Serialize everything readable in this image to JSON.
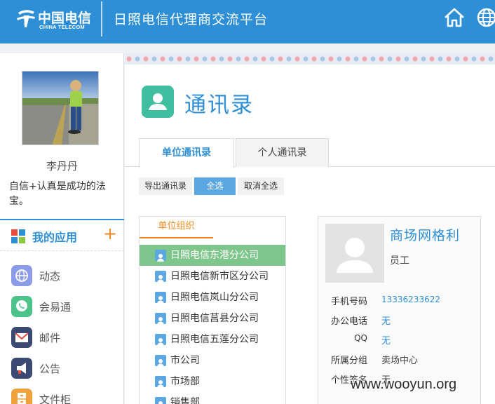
{
  "header": {
    "brand_cn": "中国电信",
    "brand_en": "CHINA TELECOM",
    "title": "日照电信代理商交流平台"
  },
  "sidebar": {
    "user_name": "李丹丹",
    "motto": "自信+认真是成功的法宝。",
    "apps_title": "我的应用",
    "apps_add": "+",
    "apps": [
      {
        "label": "动态",
        "icon": "globe-icon",
        "color": "#8b9be8"
      },
      {
        "label": "会易通",
        "icon": "phone-chat-icon",
        "color": "#4cc38a"
      },
      {
        "label": "邮件",
        "icon": "mail-icon",
        "color": "#3b4a72"
      },
      {
        "label": "公告",
        "icon": "megaphone-icon",
        "color": "#3b4a72"
      },
      {
        "label": "文件柜",
        "icon": "cabinet-icon",
        "color": "#f0a23a"
      }
    ]
  },
  "main": {
    "page_title": "通讯录",
    "tabs": [
      {
        "label": "单位通讯录",
        "active": true
      },
      {
        "label": "个人通讯录",
        "active": false
      }
    ],
    "buttons": {
      "export": "导出通讯录",
      "select_all": "全选",
      "deselect_all": "取消全选"
    },
    "org_tab": "单位组织",
    "org_list": [
      {
        "label": "日照电信东港分公司",
        "selected": true
      },
      {
        "label": "日照电信新市区分公司",
        "selected": false
      },
      {
        "label": "日照电信岚山分公司",
        "selected": false
      },
      {
        "label": "日照电信莒县分公司",
        "selected": false
      },
      {
        "label": "日照电信五莲分公司",
        "selected": false
      },
      {
        "label": "市公司",
        "selected": false
      },
      {
        "label": "市场部",
        "selected": false
      },
      {
        "label": "销售部",
        "selected": false
      }
    ],
    "contact": {
      "name": "商场网格利",
      "role": "员工",
      "fields": [
        {
          "label": "手机号码",
          "value": "13336233622",
          "link": true
        },
        {
          "label": "办公电话",
          "value": "无",
          "link": true
        },
        {
          "label": "QQ",
          "value": "无",
          "link": true
        },
        {
          "label": "所属分组",
          "value": "卖场中心",
          "link": false
        },
        {
          "label": "个性签名",
          "value": "无",
          "link": false
        }
      ]
    }
  },
  "watermark": "www.wooyun.org",
  "colors": {
    "header": "#2e8fd6",
    "accent": "#2e8fd6",
    "selected_row": "#7fc68c",
    "org_tab": "#f08a1c"
  }
}
